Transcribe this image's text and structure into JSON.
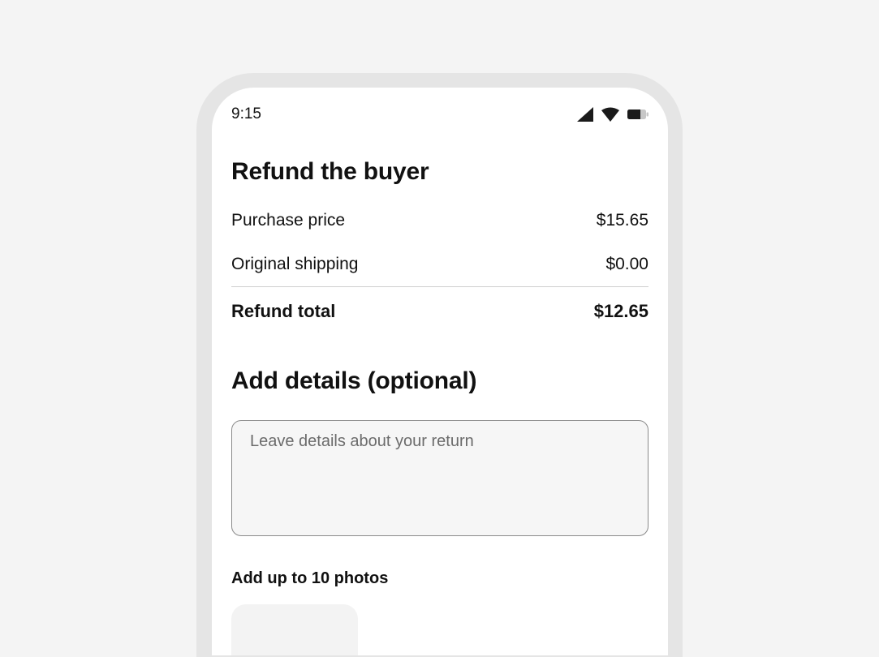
{
  "status_bar": {
    "time": "9:15",
    "icons": [
      "cellular-signal-icon",
      "wifi-icon",
      "battery-icon"
    ]
  },
  "refund": {
    "title": "Refund the buyer",
    "rows": [
      {
        "label": "Purchase price",
        "value": "$15.65"
      },
      {
        "label": "Original shipping",
        "value": "$0.00"
      }
    ],
    "total": {
      "label": "Refund total",
      "value": "$12.65"
    }
  },
  "details": {
    "title": "Add details (optional)",
    "placeholder": "Leave details about your return",
    "value": ""
  },
  "photos": {
    "label": "Add up to 10 photos"
  },
  "colors": {
    "page_background": "#f4f4f4",
    "device_frame": "#e5e5e5",
    "screen_background": "#ffffff",
    "text": "#111111",
    "input_border": "#8a8a8a",
    "input_background": "#f6f6f6",
    "placeholder": "#6b6b6b"
  }
}
